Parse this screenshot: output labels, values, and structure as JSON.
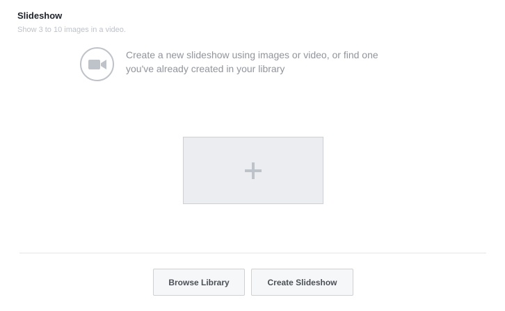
{
  "section": {
    "title": "Slideshow",
    "subtitle": "Show 3 to 10 images in a video."
  },
  "intro": {
    "icon": "video-camera-icon",
    "line1": "Create a new slideshow using images or video, or find one",
    "line2": "you've already created in your library"
  },
  "add_media": {
    "icon": "plus-icon"
  },
  "footer": {
    "browse_label": "Browse Library",
    "create_label": "Create Slideshow"
  },
  "colors": {
    "title": "#1d2129",
    "subtitle": "#bec2c9",
    "body_text": "#90949c",
    "icon": "#bec2c9",
    "button_bg": "#f6f7f9",
    "add_box_bg": "#ebedf0"
  }
}
